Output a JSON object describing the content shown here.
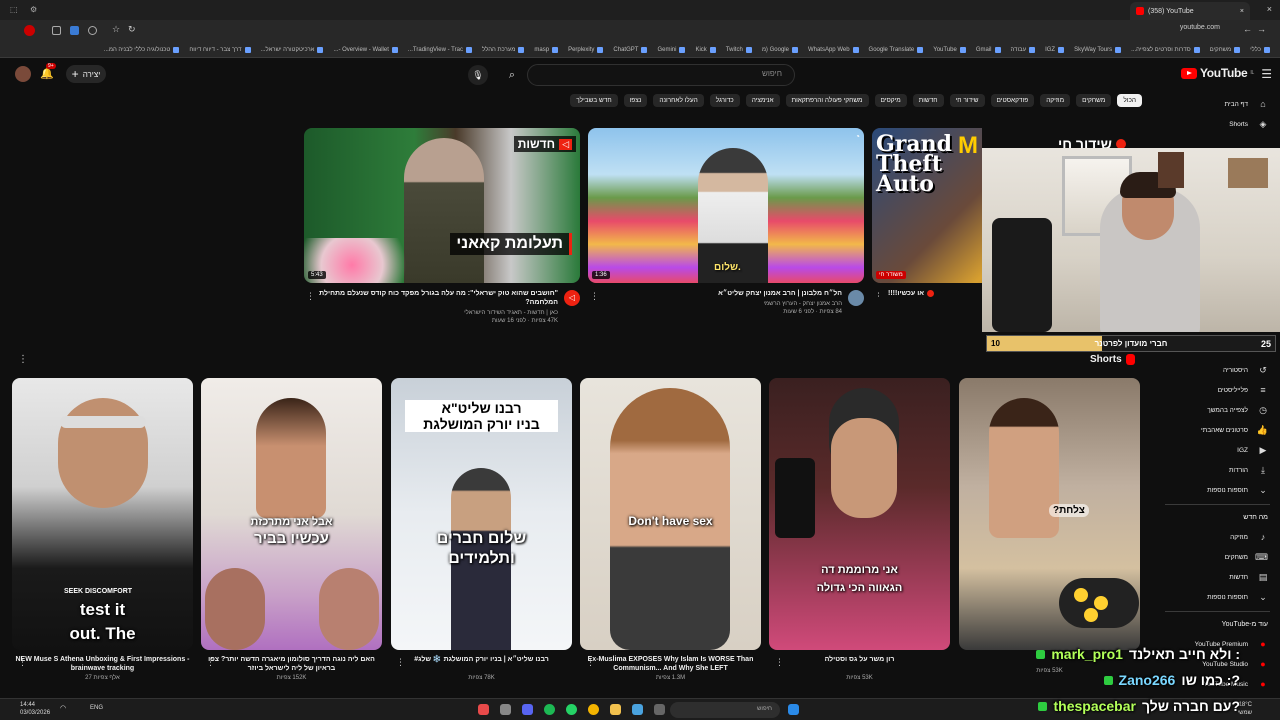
{
  "browser": {
    "tab_title": "(358) YouTube",
    "url": "youtube.com",
    "bookmarks": [
      "כללי",
      "משחקים",
      "סדרות וסרטים לצפייה...",
      "SkyWay Tours",
      "IGZ",
      "עבודה",
      "Gmail",
      "YouTube",
      "Google Translate",
      "WhatsApp Web",
      "Google (מ",
      "Twitch",
      "Kick",
      "Gemini",
      "ChatGPT",
      "Perplexity",
      "masp",
      "מערכת ההלל",
      "TradingView - Trac...",
      "Overview - Wallet -...",
      "ארכיטקטורה ישראל...",
      "דרך צבר - דיווח דיווח",
      "טכנולוגיה כללי לבניה המ..."
    ]
  },
  "header": {
    "logo_text": "YouTube",
    "logo_sup": "IL",
    "search_placeholder": "חיפוש",
    "create_label": "יצירה",
    "notif_count": "9+"
  },
  "chips": [
    "הכול",
    "משחקים",
    "מוזיקה",
    "פודקאסטים",
    "שידור חי",
    "חדשות",
    "מיקסים",
    "משחקי פעולה והרפתקאות",
    "אנימציה",
    "כדורגל",
    "העלו לאחרונה",
    "נצפו",
    "חדש בשבילך"
  ],
  "sidebar": {
    "top": [
      {
        "label": "דף הבית",
        "icon": "home-icon"
      },
      {
        "label": "Shorts",
        "icon": "shorts-icon"
      }
    ],
    "you": [
      {
        "label": "היסטוריה",
        "icon": "history-icon"
      },
      {
        "label": "פלייליסטים",
        "icon": "playlist-icon"
      },
      {
        "label": "לצפייה בהמשך",
        "icon": "clock-icon"
      },
      {
        "label": "סרטונים שאהבתי",
        "icon": "thumbs-up-icon"
      },
      {
        "label": "IGZ",
        "icon": "video-icon"
      },
      {
        "label": "הורדות",
        "icon": "download-icon"
      },
      {
        "label": "תוספות נוספות",
        "icon": "chevron-down-icon"
      }
    ],
    "new_header": "מה חדש",
    "new": [
      {
        "label": "מוזיקה",
        "icon": "music-icon"
      },
      {
        "label": "משחקים",
        "icon": "gamepad-icon"
      },
      {
        "label": "חדשות",
        "icon": "news-icon"
      },
      {
        "label": "תוספות נוספות",
        "icon": "chevron-down-icon"
      }
    ],
    "more_header": "עוד מ-YouTube",
    "more": [
      {
        "label": "YouTube Premium",
        "icon": "yt-icon"
      },
      {
        "label": "YouTube Studio",
        "icon": "yt-icon"
      },
      {
        "label": "YouTube Music",
        "icon": "yt-icon"
      }
    ]
  },
  "videos": [
    {
      "title": "\"חושבים שהוא טוק ישראלי\": מה עלה בגורל מפקד כוח קודס שנעלם מתחילת המלחמה?",
      "channel": "כאן | חדשות - תאגיד השידור הישראלי",
      "meta": "47K צפיות · לפני 16 שעות",
      "duration": "5:43",
      "overlay": "תעלומת קאאני",
      "badge": "חדשות"
    },
    {
      "title": "הל״ח מלבונן | הרב אמנון יצחק שליט״א",
      "channel": "הרב אמנון יצחק - הערוץ הרשמי",
      "meta": "84 צפיות · לפני 6 שעות",
      "duration": "1:36",
      "overlay": "שלום."
    },
    {
      "title": "או עכשיו!!!!",
      "channel": "",
      "meta": "",
      "duration": "משודר חי",
      "overlay": "שידור חי"
    }
  ],
  "shorts_header": "Shorts",
  "shorts": [
    {
      "title": "NEW Muse S Athena Unboxing & First Impressions - brainwave tracking",
      "views": "27 אלף צפיות",
      "caption1": "test it",
      "caption2": "out. The"
    },
    {
      "title": "האם ליה נוגה הדריך סולומון מיאגרה הדשה יותר? צפו בראיון של ליה לישראל ביוזר",
      "views": "152K צפיות",
      "caption1": "אבל אני מתרכזת",
      "caption2": "עכשיו בביר"
    },
    {
      "title": "רבנו שליט״א | בניו יורק המושלגת ❄️ שלג#",
      "views": "78K צפיות",
      "caption1": "שלום חברים",
      "caption2": "ותלמידים",
      "top": "רבנו שליט\"א",
      "top2": "בניו יורק המושלגת"
    },
    {
      "title": "Ex-Muslima EXPOSES Why Islam Is WORSE Than Communism... And Why She LEFT",
      "views": "1.3M צפיות",
      "caption1": "Don't have sex",
      "caption2": ""
    },
    {
      "title": "רון משר על גס וסטילה",
      "views": "53K צפיות",
      "caption1": "אני מרוממת דה",
      "caption2": "הגאווה הכי גדולה"
    },
    {
      "title": "",
      "views": "53K צפיות",
      "caption1": "צלחת?",
      "caption2": ""
    }
  ],
  "stream_overlay": {
    "sub_label": "חברי מועדון לפרטנר",
    "sub_current": "10",
    "sub_goal": "25",
    "sub_progress": 0.4,
    "chat": [
      {
        "user": "mark_pro1",
        "msg": "ולא חייב תאילנד :"
      },
      {
        "user": "Zano266",
        "msg": "כמו שו :?"
      },
      {
        "user": "thespacebar",
        "msg": "עם חברה שלך?"
      }
    ]
  },
  "taskbar": {
    "search_placeholder": "חיפוש",
    "lang": "ENG",
    "time": "14:44",
    "date": "03/03/2026",
    "weather_temp": "18°C",
    "weather_desc": "שמשי"
  },
  "colors": {
    "bg": "#0f0f0f",
    "accent": "#ff0000",
    "chip_active": "#f1f1f1"
  }
}
